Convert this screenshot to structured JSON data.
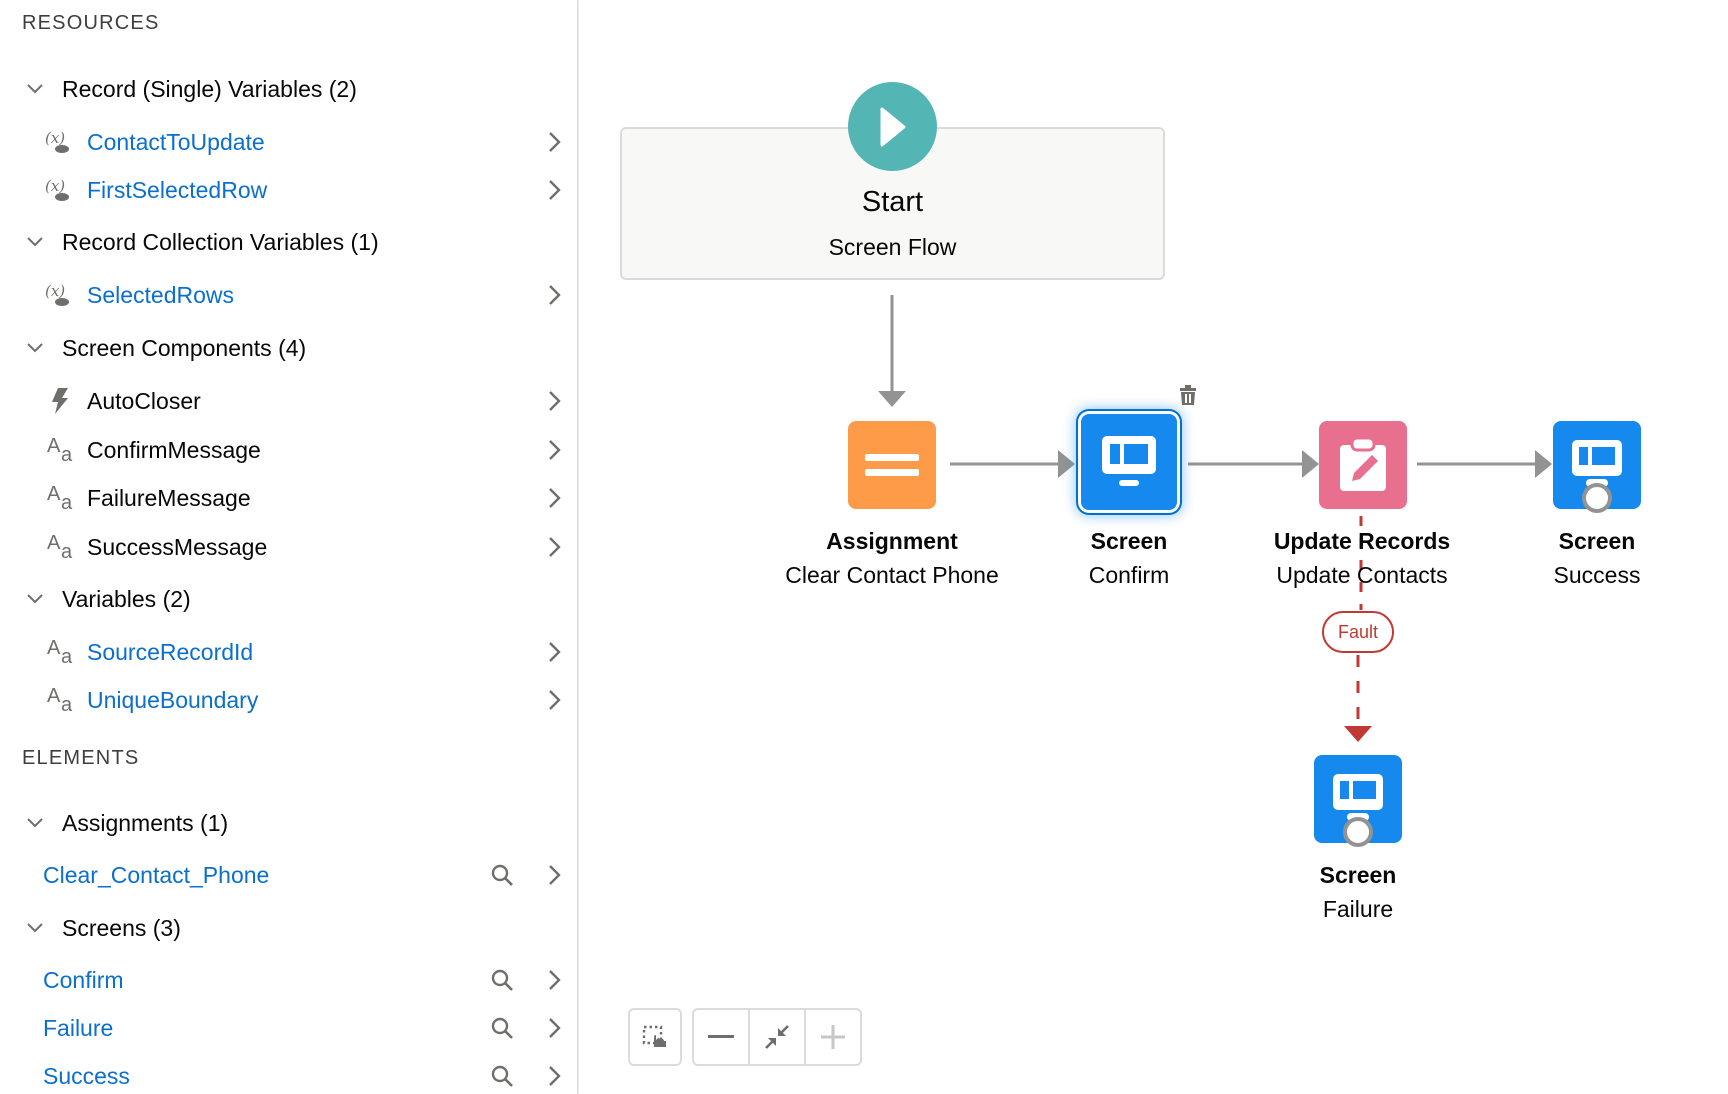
{
  "sidebar": {
    "resources_title": "RESOURCES",
    "elements_title": "ELEMENTS",
    "resource_groups": [
      {
        "label": "Record (Single) Variables (2)",
        "items": [
          {
            "label": "ContactToUpdate",
            "icon": "record-variable-icon",
            "style": "link"
          },
          {
            "label": "FirstSelectedRow",
            "icon": "record-variable-icon",
            "style": "link"
          }
        ]
      },
      {
        "label": "Record Collection Variables (1)",
        "items": [
          {
            "label": "SelectedRows",
            "icon": "record-variable-icon",
            "style": "link"
          }
        ]
      },
      {
        "label": "Screen Components (4)",
        "items": [
          {
            "label": "AutoCloser",
            "icon": "lightning-icon",
            "style": "plain"
          },
          {
            "label": "ConfirmMessage",
            "icon": "text-icon",
            "style": "plain"
          },
          {
            "label": "FailureMessage",
            "icon": "text-icon",
            "style": "plain"
          },
          {
            "label": "SuccessMessage",
            "icon": "text-icon",
            "style": "plain"
          }
        ]
      },
      {
        "label": "Variables (2)",
        "items": [
          {
            "label": "SourceRecordId",
            "icon": "text-icon",
            "style": "link"
          },
          {
            "label": "UniqueBoundary",
            "icon": "text-icon",
            "style": "link"
          }
        ]
      }
    ],
    "element_groups": [
      {
        "label": "Assignments (1)",
        "items": [
          {
            "label": "Clear_Contact_Phone"
          }
        ]
      },
      {
        "label": "Screens (3)",
        "items": [
          {
            "label": "Confirm"
          },
          {
            "label": "Failure"
          },
          {
            "label": "Success"
          }
        ]
      }
    ]
  },
  "canvas": {
    "start": {
      "title": "Start",
      "subtitle": "Screen Flow"
    },
    "nodes": [
      {
        "id": "assignment",
        "type": "Assignment",
        "label": "Clear Contact Phone",
        "color": "#fe9b48"
      },
      {
        "id": "screen-confirm",
        "type": "Screen",
        "label": "Confirm",
        "color": "#1589ee",
        "selected": true
      },
      {
        "id": "update-records",
        "type": "Update Records",
        "label": "Update Contacts",
        "color": "#e96f8e"
      },
      {
        "id": "screen-success",
        "type": "Screen",
        "label": "Success",
        "color": "#1589ee"
      },
      {
        "id": "screen-failure",
        "type": "Screen",
        "label": "Failure",
        "color": "#1589ee"
      }
    ],
    "fault_label": "Fault",
    "colors": {
      "start": "#54b5b5",
      "connector": "#939393",
      "fault": "#c23934",
      "link": "#0b6fce"
    }
  },
  "toolbar": {
    "buttons": [
      "select-elements",
      "zoom-out",
      "fit-view",
      "zoom-in"
    ]
  }
}
